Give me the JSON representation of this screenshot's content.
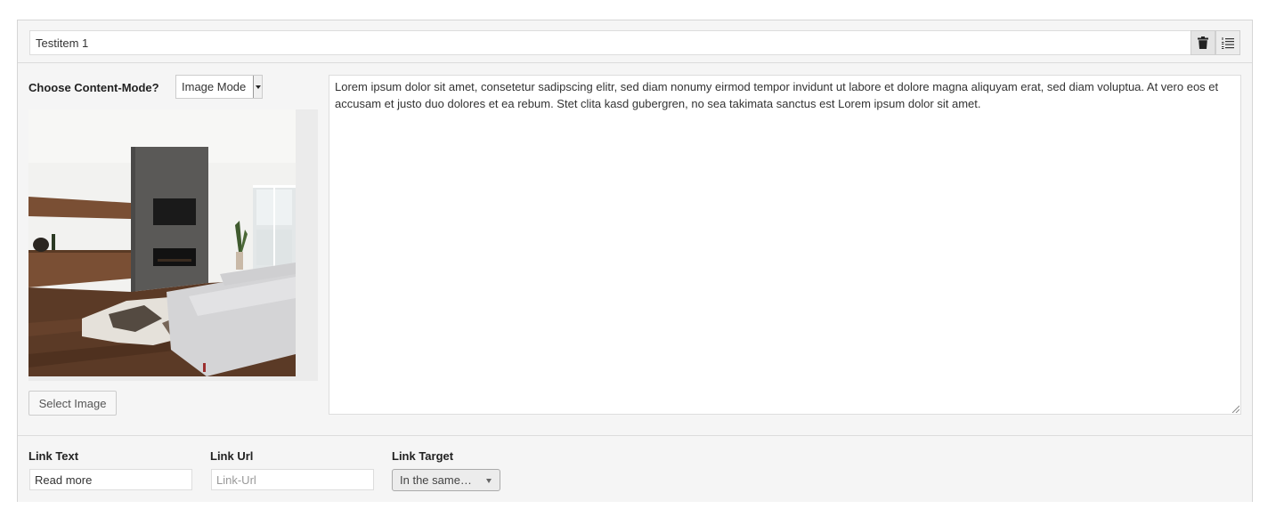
{
  "header": {
    "title_value": "Testitem 1",
    "trash_icon": "trash-icon",
    "sort_icon": "ordered-list-icon"
  },
  "content_mode": {
    "label": "Choose Content-Mode?",
    "selected": "Image Mode"
  },
  "image": {
    "alt": "living-room-photo"
  },
  "select_image_label": "Select Image",
  "text_content": "Lorem ipsum dolor sit amet, consetetur sadipscing elitr, sed diam nonumy eirmod tempor invidunt ut labore et dolore magna aliquyam erat, sed diam voluptua. At vero eos et accusam et justo duo dolores et ea rebum. Stet clita kasd gubergren, no sea takimata sanctus est Lorem ipsum dolor sit amet.",
  "link": {
    "text_label": "Link Text",
    "text_value": "Read more",
    "url_label": "Link Url",
    "url_placeholder": "Link-Url",
    "target_label": "Link Target",
    "target_selected": "In the same…"
  }
}
